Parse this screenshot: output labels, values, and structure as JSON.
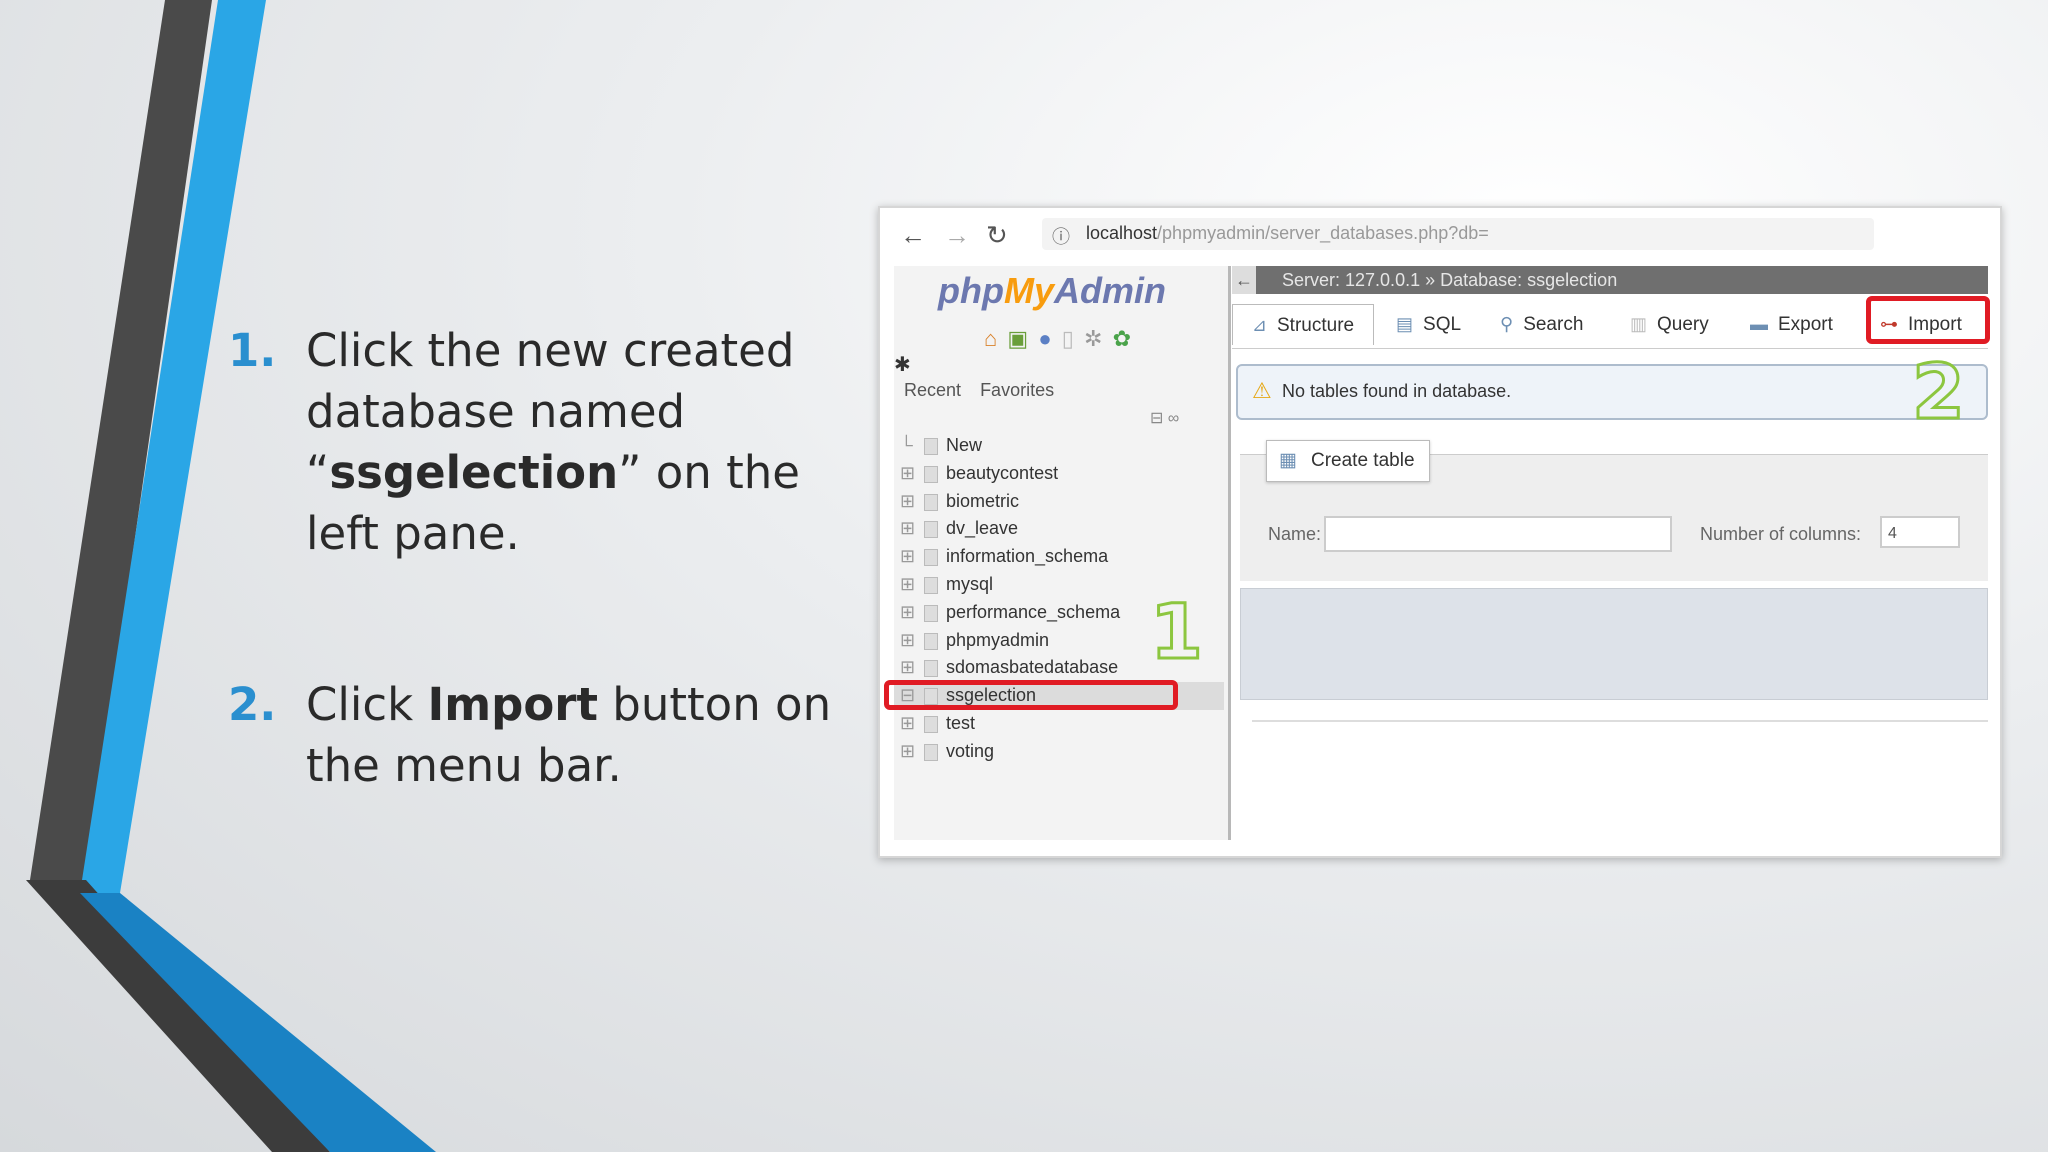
{
  "instructions": [
    {
      "number": "1.",
      "pre": "Click the new created database named “",
      "bold": "ssgelection",
      "post": "” on the left pane."
    },
    {
      "number": "2.",
      "pre": "Click ",
      "bold": "Import",
      "post": " button on the menu bar."
    }
  ],
  "browser": {
    "back_icon": "arrow-left-icon",
    "forward_icon": "arrow-right-icon",
    "reload_icon": "reload-icon",
    "url_host": "localhost",
    "url_path": "/phpmyadmin/server_databases.php?db="
  },
  "sidebar": {
    "logo_php": "php",
    "logo_my": "My",
    "logo_admin": "Admin",
    "recent_label": "Recent",
    "favorites_label": "Favorites",
    "tree": [
      {
        "label": "New"
      },
      {
        "label": "beautycontest"
      },
      {
        "label": "biometric"
      },
      {
        "label": "dv_leave"
      },
      {
        "label": "information_schema"
      },
      {
        "label": "mysql"
      },
      {
        "label": "performance_schema"
      },
      {
        "label": "phpmyadmin"
      },
      {
        "label": "sdomasbatedatabase"
      },
      {
        "label": "ssgelection"
      },
      {
        "label": "test"
      },
      {
        "label": "voting"
      }
    ]
  },
  "main": {
    "breadcrumb": "Server: 127.0.0.1 » Database: ssgelection",
    "tabs": [
      {
        "label": "Structure",
        "icon": "structure-icon"
      },
      {
        "label": "SQL",
        "icon": "sql-icon"
      },
      {
        "label": "Search",
        "icon": "search-icon"
      },
      {
        "label": "Query",
        "icon": "query-icon"
      },
      {
        "label": "Export",
        "icon": "export-icon"
      },
      {
        "label": "Import",
        "icon": "import-icon"
      }
    ],
    "notice": "No tables found in database.",
    "create_table_label": "Create table",
    "name_label": "Name:",
    "columns_label": "Number of columns:",
    "columns_value": "4"
  },
  "markers": {
    "one": "1",
    "two": "2"
  },
  "colors": {
    "accent_blue": "#2a8fcf",
    "highlight_red": "#e01b24",
    "marker_green": "#8cc63f",
    "deco_dark": "#4a4a4a",
    "deco_blue": "#2aa6e6"
  }
}
